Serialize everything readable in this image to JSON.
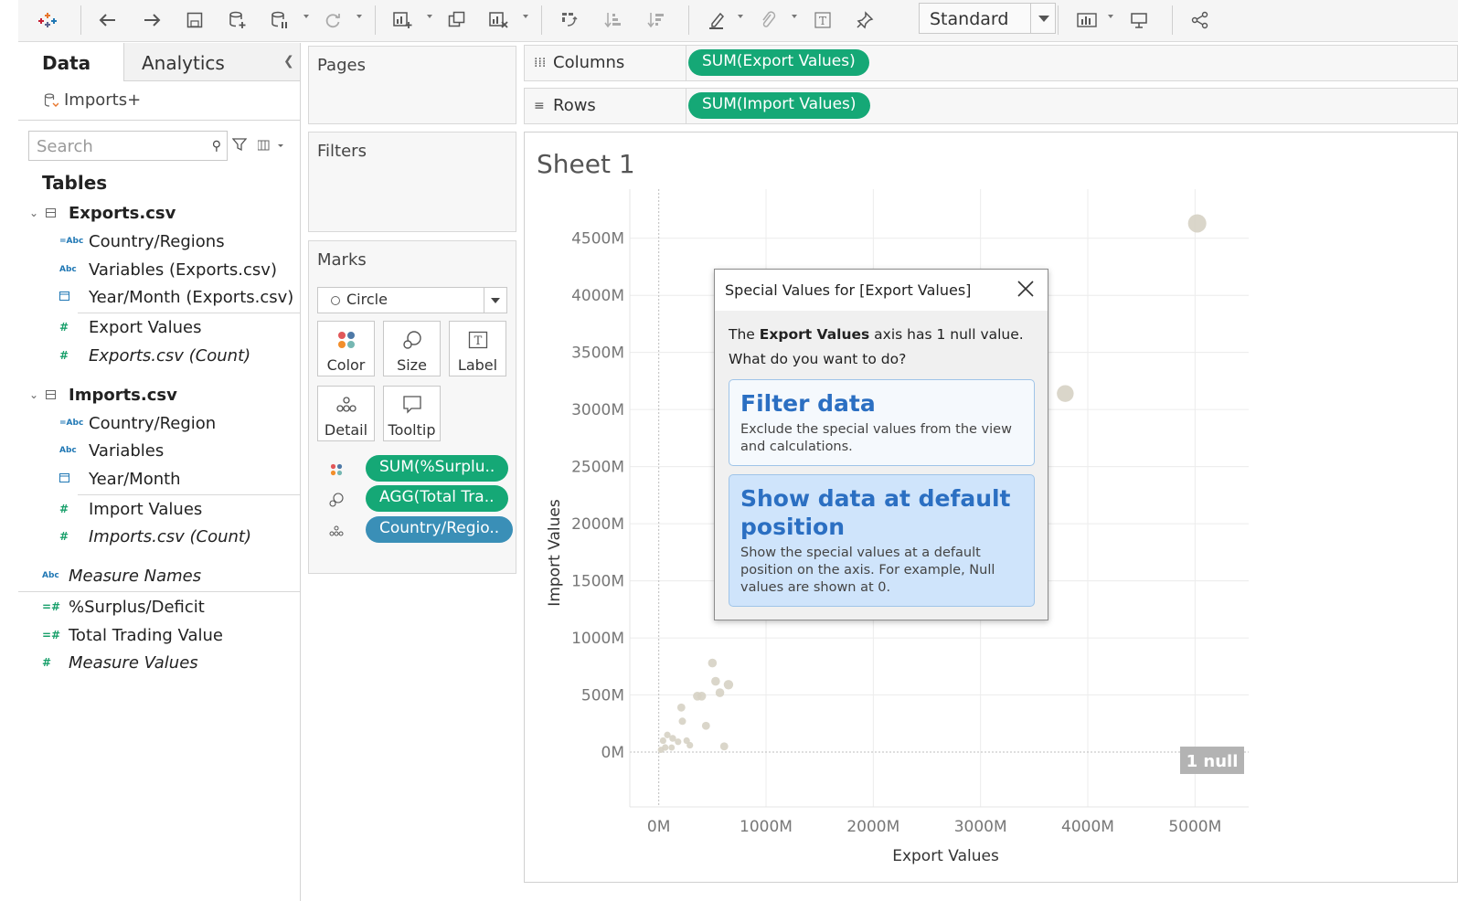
{
  "toolbar": {
    "view_size": "Standard"
  },
  "data_pane": {
    "tabs": [
      "Data",
      "Analytics"
    ],
    "datasource": "Imports+",
    "search_placeholder": "Search",
    "tables_label": "Tables",
    "tables": [
      {
        "name": "Exports.csv",
        "dims": [
          {
            "type": "Abc",
            "name": "Country/Regions"
          },
          {
            "type": "Abc",
            "name": "Variables (Exports.csv)"
          },
          {
            "type": "date",
            "name": "Year/Month (Exports.csv)"
          }
        ],
        "measures": [
          {
            "type": "#",
            "name": "Export Values"
          },
          {
            "type": "#",
            "name": "Exports.csv (Count)"
          }
        ]
      },
      {
        "name": "Imports.csv",
        "dims": [
          {
            "type": "Abc",
            "name": "Country/Region"
          },
          {
            "type": "Abc",
            "name": "Variables"
          },
          {
            "type": "date",
            "name": "Year/Month"
          }
        ],
        "measures": [
          {
            "type": "#",
            "name": "Import Values"
          },
          {
            "type": "#",
            "name": "Imports.csv (Count)"
          }
        ]
      }
    ],
    "extra": [
      {
        "type": "Abc",
        "name": "Measure Names"
      },
      {
        "type": "=#",
        "name": "%Surplus/Deficit"
      },
      {
        "type": "=#",
        "name": "Total Trading Value"
      },
      {
        "type": "#",
        "name": "Measure Values"
      }
    ]
  },
  "cards": {
    "pages": "Pages",
    "filters": "Filters",
    "marks": "Marks",
    "mark_type": "Circle",
    "buttons": [
      "Color",
      "Size",
      "Label",
      "Detail",
      "Tooltip"
    ],
    "pills": [
      "SUM(%Surplu..",
      "AGG(Total Tra..",
      "Country/Regio.."
    ]
  },
  "shelves": {
    "columns_label": "Columns",
    "columns_pill": "SUM(Export Values)",
    "rows_label": "Rows",
    "rows_pill": "SUM(Import Values)"
  },
  "sheet_title": "Sheet 1",
  "chart_data": {
    "type": "scatter",
    "xlabel": "Export Values",
    "ylabel": "Import Values",
    "xlim": [
      -270,
      5500
    ],
    "ylim": [
      -480,
      4930
    ],
    "x_ticks": [
      0,
      1000,
      2000,
      3000,
      4000,
      5000
    ],
    "x_tick_labels": [
      "0M",
      "1000M",
      "2000M",
      "3000M",
      "4000M",
      "5000M"
    ],
    "y_ticks": [
      0,
      500,
      1000,
      1500,
      2000,
      2500,
      3000,
      3500,
      4000,
      4500
    ],
    "y_tick_labels": [
      "0M",
      "500M",
      "1000M",
      "1500M",
      "2000M",
      "2500M",
      "3000M",
      "3500M",
      "4000M",
      "4500M"
    ],
    "points": [
      {
        "x": 5020,
        "y": 4630,
        "size": 1
      },
      {
        "x": 3790,
        "y": 3140,
        "size": 0.9
      },
      {
        "x": 500,
        "y": 780,
        "size": 0.35
      },
      {
        "x": 530,
        "y": 620,
        "size": 0.35
      },
      {
        "x": 650,
        "y": 590,
        "size": 0.4
      },
      {
        "x": 570,
        "y": 520,
        "size": 0.35
      },
      {
        "x": 360,
        "y": 490,
        "size": 0.35
      },
      {
        "x": 400,
        "y": 490,
        "size": 0.35
      },
      {
        "x": 210,
        "y": 390,
        "size": 0.3
      },
      {
        "x": 440,
        "y": 230,
        "size": 0.3
      },
      {
        "x": 220,
        "y": 270,
        "size": 0.25
      },
      {
        "x": 610,
        "y": 50,
        "size": 0.3
      },
      {
        "x": 130,
        "y": 120,
        "size": 0.22
      },
      {
        "x": 80,
        "y": 150,
        "size": 0.2
      },
      {
        "x": 40,
        "y": 100,
        "size": 0.2
      },
      {
        "x": 180,
        "y": 90,
        "size": 0.2
      },
      {
        "x": 260,
        "y": 100,
        "size": 0.2
      },
      {
        "x": 60,
        "y": 40,
        "size": 0.2
      },
      {
        "x": 20,
        "y": 20,
        "size": 0.18
      },
      {
        "x": 120,
        "y": 40,
        "size": 0.18
      },
      {
        "x": 290,
        "y": 60,
        "size": 0.2
      }
    ],
    "null_indicator": "1 null"
  },
  "dialog": {
    "title": "Special Values for [Export Values]",
    "msg_pre": "The ",
    "msg_bold": "Export Values",
    "msg_post": " axis has 1 null value.",
    "question": "What do you want to do?",
    "option1_title": "Filter data",
    "option1_desc": "Exclude the special values from the view and calculations.",
    "option2_title": "Show data at default position",
    "option2_desc": "Show the special values at a default position on the axis. For example, Null values are shown at 0."
  },
  "colors": {
    "pill_green": "#15a876",
    "pill_blue": "#3a8fb7",
    "mark": "#d6d2c4",
    "dialog_option_selected": "#cfe4fb",
    "dialog_link": "#2b6fc2"
  }
}
